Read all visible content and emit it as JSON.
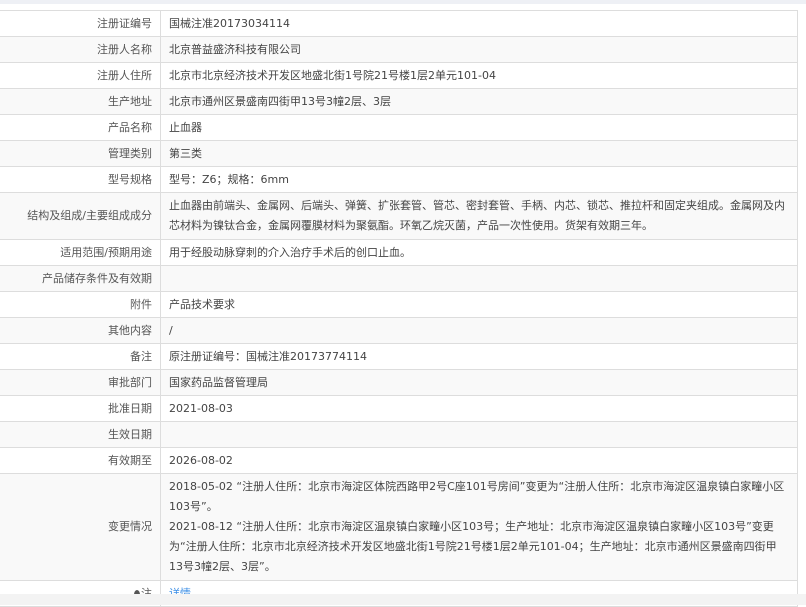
{
  "rows": [
    {
      "label": "注册证编号",
      "value": "国械注准20173034114"
    },
    {
      "label": "注册人名称",
      "value": "北京普益盛济科技有限公司"
    },
    {
      "label": "注册人住所",
      "value": "北京市北京经济技术开发区地盛北街1号院21号楼1层2单元101-04"
    },
    {
      "label": "生产地址",
      "value": "北京市通州区景盛南四街甲13号3幢2层、3层"
    },
    {
      "label": "产品名称",
      "value": "止血器"
    },
    {
      "label": "管理类别",
      "value": "第三类"
    },
    {
      "label": "型号规格",
      "value": "型号：Z6；规格：6mm"
    },
    {
      "label": "结构及组成/主要组成成分",
      "value": "止血器由前端头、金属网、后端头、弹簧、扩张套管、管芯、密封套管、手柄、内芯、锁芯、推拉杆和固定夹组成。金属网及内芯材料为镍钛合金，金属网覆膜材料为聚氨酯。环氧乙烷灭菌，产品一次性使用。货架有效期三年。"
    },
    {
      "label": "适用范围/预期用途",
      "value": "用于经股动脉穿刺的介入治疗手术后的创口止血。"
    },
    {
      "label": "产品储存条件及有效期",
      "value": ""
    },
    {
      "label": "附件",
      "value": "产品技术要求"
    },
    {
      "label": "其他内容",
      "value": "/"
    },
    {
      "label": "备注",
      "value": "原注册证编号：国械注准20173774114"
    },
    {
      "label": "审批部门",
      "value": "国家药品监督管理局"
    },
    {
      "label": "批准日期",
      "value": "2021-08-03"
    },
    {
      "label": "生效日期",
      "value": ""
    },
    {
      "label": "有效期至",
      "value": "2026-08-02"
    }
  ],
  "changes": {
    "label": "变更情况",
    "entries": [
      "2018-05-02 “注册人住所：北京市海淀区体院西路甲2号C座101号房间”变更为“注册人住所：北京市海淀区温泉镇白家疃小区103号”。",
      "2021-08-12 “注册人住所：北京市海淀区温泉镇白家疃小区103号；生产地址：北京市海淀区温泉镇白家疃小区103号”变更为“注册人住所：北京市北京经济技术开发区地盛北街1号院21号楼1层2单元101-04；生产地址：北京市通州区景盛南四街甲13号3幢2层、3层”。"
    ]
  },
  "note": {
    "label": "注",
    "link": "详情",
    "icon": "map-pin-icon"
  }
}
